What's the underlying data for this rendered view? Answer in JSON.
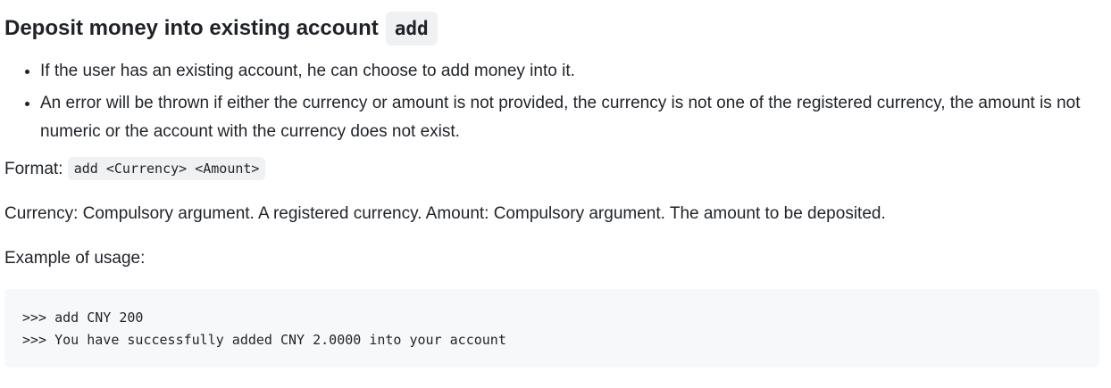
{
  "section": {
    "title": "Deposit money into existing account",
    "command": "add"
  },
  "bullets": [
    "If the user has an existing account, he can choose to add money into it.",
    "An error will be thrown if either the currency or amount is not provided, the currency is not one of the registered currency, the amount is not numeric or the account with the currency does not exist."
  ],
  "format": {
    "label": "Format:",
    "code": "add <Currency> <Amount>"
  },
  "description": "Currency: Compulsory argument. A registered currency. Amount: Compulsory argument. The amount to be deposited.",
  "example_label": "Example of usage:",
  "example_code": [
    ">>> add CNY 200",
    ">>> You have successfully added CNY 2.0000 into your account"
  ]
}
